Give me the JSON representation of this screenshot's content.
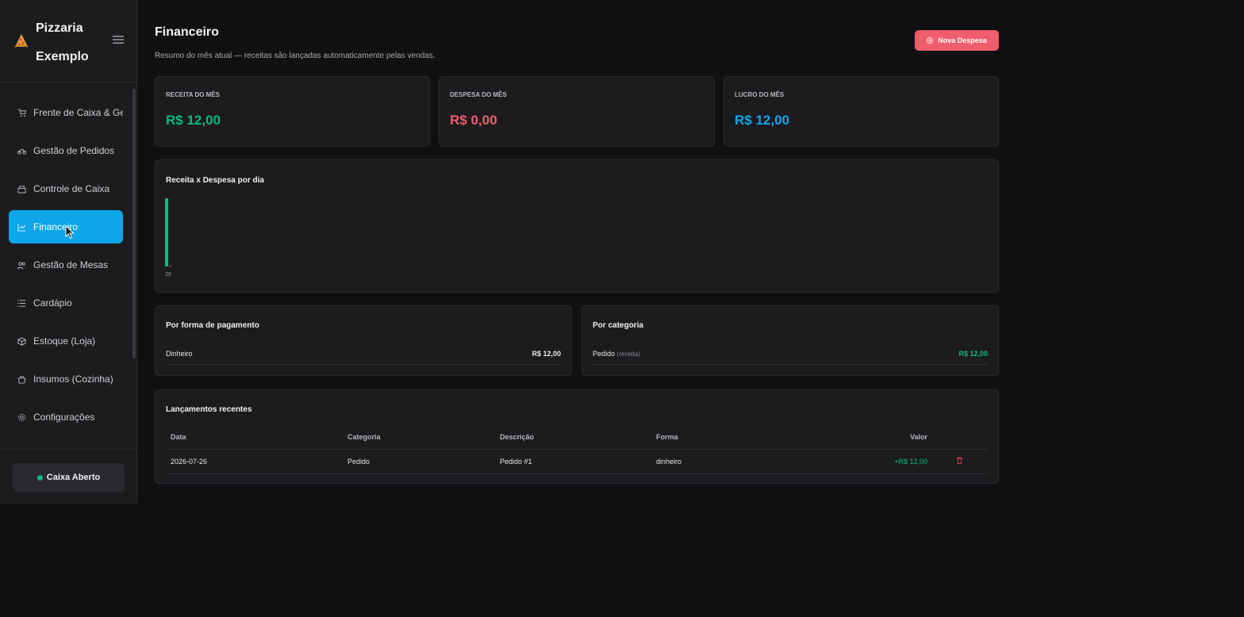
{
  "sidebar": {
    "brand_line1": "Pizzaria",
    "brand_line2": "Exemplo",
    "items": [
      {
        "label": "Frente de Caixa & Gestor",
        "icon": "cart-icon"
      },
      {
        "label": "Gestão de Pedidos",
        "icon": "motorbike-icon"
      },
      {
        "label": "Controle de Caixa",
        "icon": "cash-register-icon"
      },
      {
        "label": "Financeiro",
        "icon": "chart-line-icon"
      },
      {
        "label": "Gestão de Mesas",
        "icon": "users-icon"
      },
      {
        "label": "Cardápio",
        "icon": "list-icon"
      },
      {
        "label": "Estoque (Loja)",
        "icon": "box-icon"
      },
      {
        "label": "Insumos (Cozinha)",
        "icon": "pot-icon"
      },
      {
        "label": "Configurações",
        "icon": "gear-icon"
      }
    ],
    "active_item": "Financeiro",
    "status_label": "Caixa Aberto"
  },
  "header": {
    "title": "Financeiro",
    "subtitle": "Resumo do mês atual — receitas são lançadas automaticamente pelas vendas.",
    "new_expense_label": "Nova Despesa"
  },
  "kpis": [
    {
      "label": "RECEITA DO MÊS",
      "value": "R$ 12,00",
      "color": "#10b981"
    },
    {
      "label": "DESPESA DO MÊS",
      "value": "R$ 0,00",
      "color": "#f05d6c"
    },
    {
      "label": "LUCRO DO MÊS",
      "value": "R$ 12,00",
      "color": "#0ea5e9"
    }
  ],
  "chart_data": {
    "type": "bar",
    "title": "Receita x Despesa por dia",
    "categories": [
      "26"
    ],
    "series": [
      {
        "values": [
          12
        ],
        "color": "#10b981"
      },
      {
        "values": [
          0
        ],
        "color": "#f05d6c"
      }
    ]
  },
  "payment": {
    "title": "Por forma de pagamento",
    "rows": [
      {
        "label": "Dinheiro",
        "value": "R$ 12,00"
      }
    ]
  },
  "category": {
    "title": "Por categoria",
    "rows": [
      {
        "label": "Pedido",
        "tag": "(receita)",
        "value": "R$ 12,00"
      }
    ]
  },
  "recent": {
    "title": "Lançamentos recentes",
    "columns": [
      "Data",
      "Categoria",
      "Descrição",
      "Forma",
      "Valor"
    ],
    "rows": [
      {
        "data": "2026-07-26",
        "categoria": "Pedido",
        "descricao": "Pedido #1",
        "forma": "dinheiro",
        "valor": "+R$ 12,00"
      }
    ]
  }
}
